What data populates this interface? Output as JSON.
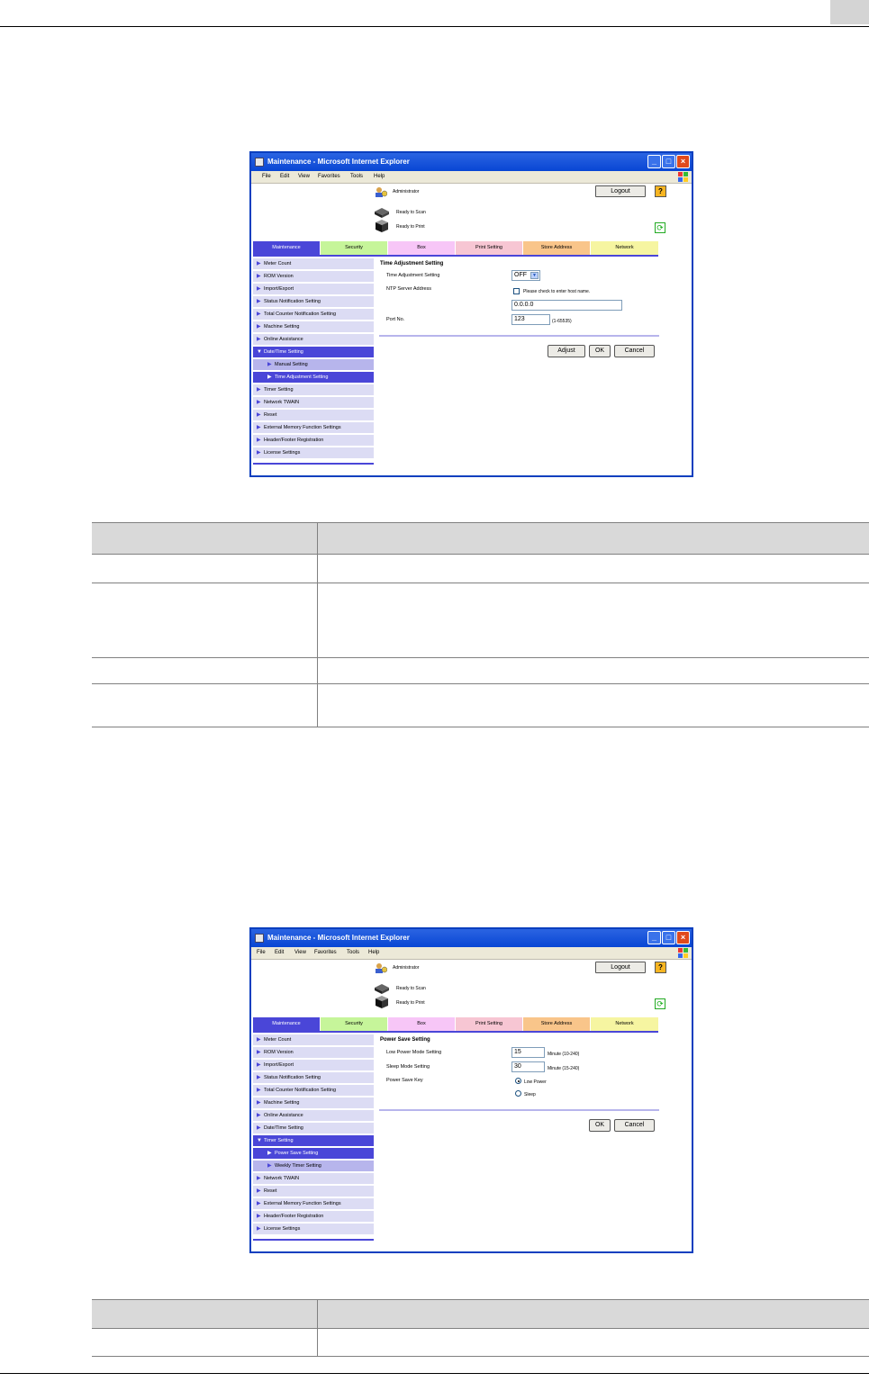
{
  "screens": [
    {
      "window_title": "Maintenance - Microsoft Internet Explorer",
      "menu": [
        "File",
        "Edit",
        "View",
        "Favorites",
        "Tools",
        "Help"
      ],
      "user": "Administrator",
      "logout_label": "Logout",
      "help_label": "?",
      "status": [
        "Ready to Scan",
        "Ready to Print"
      ],
      "tabs": [
        {
          "label": "Maintenance",
          "color": "#4a46d8"
        },
        {
          "label": "Security",
          "color": "#c6f59a"
        },
        {
          "label": "Box",
          "color": "#f7c6f7"
        },
        {
          "label": "Print Setting",
          "color": "#f7c6d3"
        },
        {
          "label": "Store Address",
          "color": "#f9c58a"
        },
        {
          "label": "Network",
          "color": "#f6f5a1"
        }
      ],
      "sidebar": [
        "Meter Count",
        "ROM Version",
        "Import/Export",
        "Status Notification Setting",
        "Total Counter Notification Setting",
        "Machine Setting",
        "Online Assistance",
        "Date/Time Setting",
        "Manual Setting",
        "Time Adjustment Setting",
        "Timer Setting",
        "Network TWAIN",
        "Reset",
        "External Memory Function Settings",
        "Header/Footer Registration",
        "License Settings"
      ],
      "panel": {
        "title": "Time Adjustment Setting",
        "time_adjustment_label": "Time Adjustment Setting",
        "time_adjustment_value": "OFF",
        "ntp_label": "NTP Server Address",
        "ntp_checkbox_label": "Please check to enter host name.",
        "ntp_value": "0.0.0.0",
        "port_label": "Port No.",
        "port_value": "123",
        "port_hint": "(1-65535)",
        "buttons": [
          "Adjust",
          "OK",
          "Cancel"
        ]
      }
    },
    {
      "window_title": "Maintenance - Microsoft Internet Explorer",
      "menu": [
        "File",
        "Edit",
        "View",
        "Favorites",
        "Tools",
        "Help"
      ],
      "user": "Administrator",
      "logout_label": "Logout",
      "help_label": "?",
      "status": [
        "Ready to Scan",
        "Ready to Print"
      ],
      "tabs": [
        {
          "label": "Maintenance",
          "color": "#4a46d8"
        },
        {
          "label": "Security",
          "color": "#c6f59a"
        },
        {
          "label": "Box",
          "color": "#f7c6f7"
        },
        {
          "label": "Print Setting",
          "color": "#f7c6d3"
        },
        {
          "label": "Store Address",
          "color": "#f9c58a"
        },
        {
          "label": "Network",
          "color": "#f6f5a1"
        }
      ],
      "sidebar": [
        "Meter Count",
        "ROM Version",
        "Import/Export",
        "Status Notification Setting",
        "Total Counter Notification Setting",
        "Machine Setting",
        "Online Assistance",
        "Date/Time Setting",
        "Timer Setting",
        "Power Save Setting",
        "Weekly Timer Setting",
        "Network TWAIN",
        "Reset",
        "External Memory Function Settings",
        "Header/Footer Registration",
        "License Settings"
      ],
      "panel": {
        "title": "Power Save Setting",
        "low_power_label": "Low Power Mode Setting",
        "low_power_value": "15",
        "low_power_hint": "Minute (10-240)",
        "sleep_label": "Sleep Mode Setting",
        "sleep_value": "30",
        "sleep_hint": "Minute (15-240)",
        "key_label": "Power Save Key",
        "key_options": [
          "Low Power",
          "Sleep"
        ],
        "buttons": [
          "OK",
          "Cancel"
        ]
      }
    }
  ]
}
